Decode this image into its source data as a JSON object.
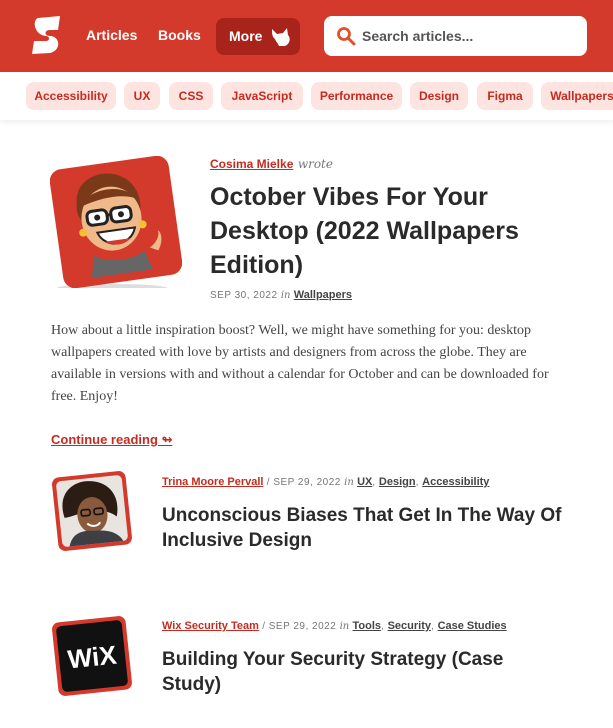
{
  "header": {
    "nav": [
      "Articles",
      "Books"
    ],
    "more_label": "More",
    "search_placeholder": "Search articles...",
    "brand_color": "#d33a2c"
  },
  "tags": [
    "Accessibility",
    "UX",
    "CSS",
    "JavaScript",
    "Performance",
    "Design",
    "Figma",
    "Wallpapers"
  ],
  "featured": {
    "author": "Cosima Mielke",
    "wrote": "wrote",
    "title": "October Vibes For Your Desktop (2022 Wallpapers Edition)",
    "date": "SEP 30, 2022",
    "in": "in",
    "category": "Wallpapers",
    "excerpt": "How about a little inspiration boost? Well, we might have something for you: desktop wallpapers created with love by artists and designers from across the globe. They are available in versions with and without a calendar for October and can be downloaded for free. Enjoy!",
    "continue": "Continue reading ↬"
  },
  "articles": [
    {
      "author": "Trina Moore Pervall",
      "date": "SEP 29, 2022",
      "in": "in",
      "categories": [
        "UX",
        "Design",
        "Accessibility"
      ],
      "title": "Unconscious Biases That Get In The Way Of Inclusive Design"
    },
    {
      "author": "Wix Security Team",
      "date": "SEP 29, 2022",
      "in": "in",
      "categories": [
        "Tools",
        "Security",
        "Case Studies"
      ],
      "title": "Building Your Security Strategy (Case Study)",
      "logo_text": "WiX"
    }
  ]
}
